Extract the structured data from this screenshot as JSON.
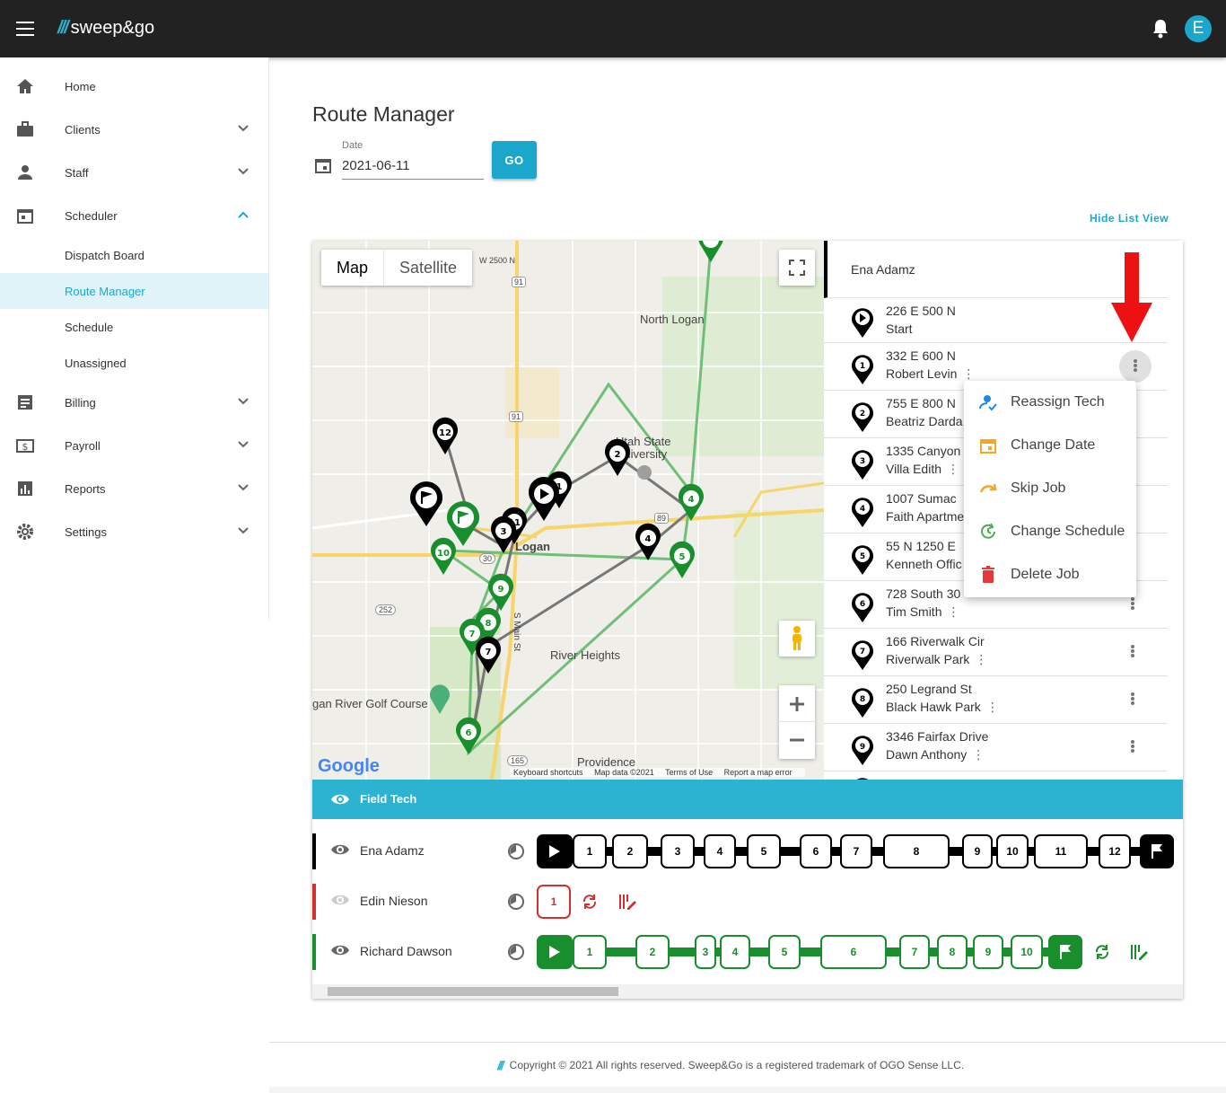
{
  "app": {
    "brand": "sweep&go",
    "avatar_letter": "E"
  },
  "sidebar": {
    "items": [
      {
        "label": "Home",
        "icon": "home-icon"
      },
      {
        "label": "Clients",
        "icon": "briefcase-icon"
      },
      {
        "label": "Staff",
        "icon": "person-icon"
      },
      {
        "label": "Scheduler",
        "icon": "calendar-icon"
      },
      {
        "label": "Billing",
        "icon": "list-icon"
      },
      {
        "label": "Payroll",
        "icon": "dollar-icon"
      },
      {
        "label": "Reports",
        "icon": "chart-icon"
      },
      {
        "label": "Settings",
        "icon": "gear-icon"
      }
    ],
    "scheduler_sub": [
      "Dispatch Board",
      "Route Manager",
      "Schedule",
      "Unassigned"
    ],
    "active_sub": "Route Manager"
  },
  "page": {
    "title": "Route Manager",
    "date_label": "Date",
    "date_value": "2021-06-11",
    "go_label": "GO",
    "hide_list_label": "Hide List View"
  },
  "map": {
    "tabs": [
      "Map",
      "Satellite"
    ],
    "places": [
      "North Logan",
      "Utah State",
      "University",
      "River Heights",
      "Providence",
      "gan River Golf Course",
      "Logan"
    ],
    "road_labels": [
      "W 2500 N",
      "91",
      "91",
      "89",
      "30",
      "252",
      "165",
      "S Main St"
    ],
    "google": "Google",
    "footer": [
      "Keyboard shortcuts",
      "Map data ©2021",
      "Terms of Use",
      "Report a map error"
    ]
  },
  "route_list": {
    "tech": "Ena Adamz",
    "stops": [
      {
        "num": "",
        "address": "226 E 500 N",
        "name": "Start"
      },
      {
        "num": "1",
        "address": "332 E 600 N",
        "name": "Robert Levin"
      },
      {
        "num": "2",
        "address": "755 E 800 N",
        "name": "Beatriz Darda"
      },
      {
        "num": "3",
        "address": "1335 Canyon",
        "name": "Villa Edith"
      },
      {
        "num": "4",
        "address": "1007 Sumac",
        "name": "Faith Apartme"
      },
      {
        "num": "5",
        "address": "55 N 1250 E",
        "name": "Kenneth Offic"
      },
      {
        "num": "6",
        "address": "728 South 30",
        "name": "Tim Smith"
      },
      {
        "num": "7",
        "address": "166 Riverwalk Cir",
        "name": "Riverwalk Park"
      },
      {
        "num": "8",
        "address": "250 Legrand St",
        "name": "Black Hawk Park"
      },
      {
        "num": "9",
        "address": "3346 Fairfax Drive",
        "name": "Dawn Anthony"
      }
    ]
  },
  "context_menu": {
    "items": [
      {
        "label": "Reassign Tech",
        "icon": "reassign-person-icon",
        "color": "#1e88e5"
      },
      {
        "label": "Change Date",
        "icon": "calendar-icon",
        "color": "#f5a623"
      },
      {
        "label": "Skip Job",
        "icon": "skip-arrow-icon",
        "color": "#f5a623"
      },
      {
        "label": "Change Schedule",
        "icon": "schedule-refresh-icon",
        "color": "#4caf50"
      },
      {
        "label": "Delete Job",
        "icon": "trash-icon",
        "color": "#e53935"
      }
    ]
  },
  "field_tech": {
    "label": "Field Tech",
    "techs": [
      {
        "name": "Ena Adamz",
        "color": "#000000",
        "stops": [
          "1",
          "2",
          "3",
          "4",
          "5",
          "6",
          "7",
          "8",
          "9",
          "10",
          "11",
          "12"
        ]
      },
      {
        "name": "Edin Nieson",
        "color": "#d0312d",
        "stops": [
          "1"
        ]
      },
      {
        "name": "Richard Dawson",
        "color": "#188f2c",
        "stops": [
          "1",
          "2",
          "3",
          "4",
          "5",
          "6",
          "7",
          "8",
          "9",
          "10"
        ]
      }
    ]
  },
  "footer": {
    "text": "Copyright © 2021 All rights reserved. Sweep&Go is a registered trademark of OGO Sense LLC."
  },
  "colors": {
    "accent": "#1ba6cc",
    "topbar": "#222222",
    "green": "#188f2c",
    "red": "#d0312d"
  }
}
